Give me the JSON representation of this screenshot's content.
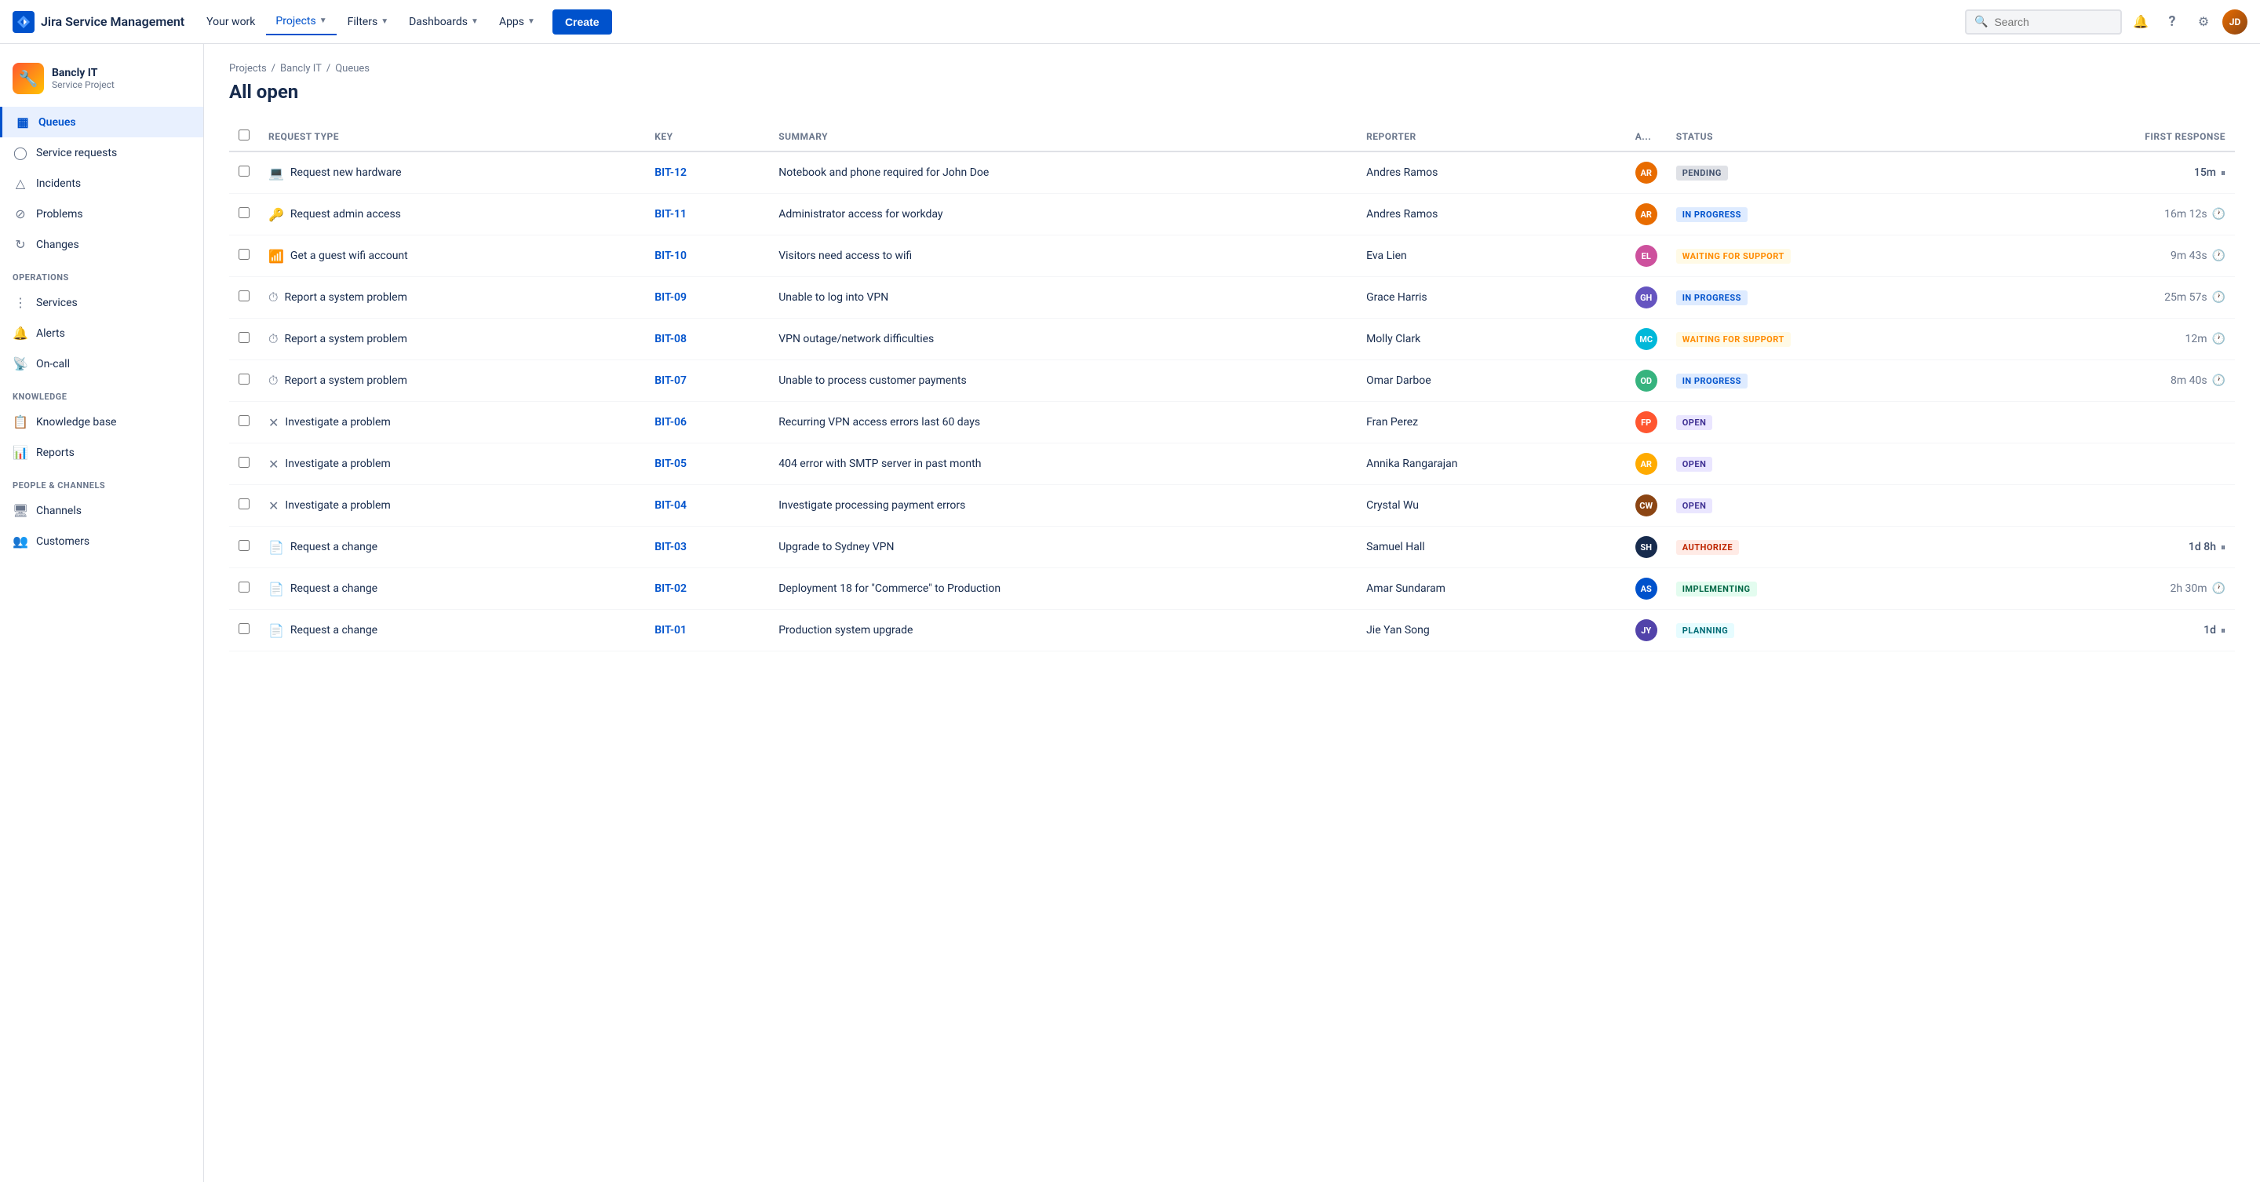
{
  "app": {
    "name": "Jira Service Management"
  },
  "topnav": {
    "your_work": "Your work",
    "projects": "Projects",
    "filters": "Filters",
    "dashboards": "Dashboards",
    "apps": "Apps",
    "create": "Create",
    "search_placeholder": "Search"
  },
  "sidebar": {
    "project_name": "Bancly IT",
    "project_type": "Service Project",
    "items": [
      {
        "id": "queues",
        "label": "Queues",
        "icon": "▦",
        "active": true
      },
      {
        "id": "service-requests",
        "label": "Service requests",
        "icon": "◯"
      },
      {
        "id": "incidents",
        "label": "Incidents",
        "icon": "△"
      },
      {
        "id": "problems",
        "label": "Problems",
        "icon": "⊘"
      },
      {
        "id": "changes",
        "label": "Changes",
        "icon": "⟳"
      }
    ],
    "sections": [
      {
        "label": "OPERATIONS",
        "items": [
          {
            "id": "services",
            "label": "Services",
            "icon": "⋮"
          },
          {
            "id": "alerts",
            "label": "Alerts",
            "icon": "🔔"
          },
          {
            "id": "on-call",
            "label": "On-call",
            "icon": "📡"
          }
        ]
      },
      {
        "label": "KNOWLEDGE",
        "items": [
          {
            "id": "knowledge-base",
            "label": "Knowledge base",
            "icon": "📋"
          },
          {
            "id": "reports",
            "label": "Reports",
            "icon": "📊"
          }
        ]
      },
      {
        "label": "PEOPLE & CHANNELS",
        "items": [
          {
            "id": "channels",
            "label": "Channels",
            "icon": "🖥"
          },
          {
            "id": "customers",
            "label": "Customers",
            "icon": "👥"
          }
        ]
      }
    ]
  },
  "breadcrumb": {
    "projects": "Projects",
    "bancly_it": "Bancly IT",
    "queues": "Queues"
  },
  "page": {
    "title": "All open"
  },
  "table": {
    "headers": {
      "request_type": "Request Type",
      "key": "Key",
      "summary": "Summary",
      "reporter": "Reporter",
      "assignee": "A...",
      "status": "Status",
      "first_response": "First response"
    },
    "rows": [
      {
        "id": "BIT-12",
        "request_type": "Request new hardware",
        "req_icon": "💻",
        "key": "BIT-12",
        "summary": "Notebook and phone required for John Doe",
        "reporter": "Andres Ramos",
        "assignee_color": "#E86C00",
        "assignee_initials": "AR",
        "status": "PENDING",
        "status_class": "badge-pending",
        "first_response": "15m",
        "response_paused": true,
        "has_clock": false
      },
      {
        "id": "BIT-11",
        "request_type": "Request admin access",
        "req_icon": "🔑",
        "key": "BIT-11",
        "summary": "Administrator access for workday",
        "reporter": "Andres Ramos",
        "assignee_color": "#E86C00",
        "assignee_initials": "AR",
        "status": "IN PROGRESS",
        "status_class": "badge-in-progress",
        "first_response": "16m 12s",
        "response_paused": false,
        "has_clock": true
      },
      {
        "id": "BIT-10",
        "request_type": "Get a guest wifi account",
        "req_icon": "📶",
        "key": "BIT-10",
        "summary": "Visitors need access to wifi",
        "reporter": "Eva Lien",
        "assignee_color": "#CD519D",
        "assignee_initials": "EL",
        "status": "WAITING FOR SUPPORT",
        "status_class": "badge-waiting",
        "first_response": "9m 43s",
        "response_paused": false,
        "has_clock": true
      },
      {
        "id": "BIT-09",
        "request_type": "Report a system problem",
        "req_icon": "⏱",
        "key": "BIT-09",
        "summary": "Unable to log into VPN",
        "reporter": "Grace Harris",
        "assignee_color": "#6554C0",
        "assignee_initials": "GH",
        "status": "IN PROGRESS",
        "status_class": "badge-in-progress",
        "first_response": "25m 57s",
        "response_paused": false,
        "has_clock": true
      },
      {
        "id": "BIT-08",
        "request_type": "Report a system problem",
        "req_icon": "⏱",
        "key": "BIT-08",
        "summary": "VPN outage/network difficulties",
        "reporter": "Molly Clark",
        "assignee_color": "#00B8D9",
        "assignee_initials": "MC",
        "status": "WAITING FOR SUPPORT",
        "status_class": "badge-waiting",
        "first_response": "12m",
        "response_paused": false,
        "has_clock": true
      },
      {
        "id": "BIT-07",
        "request_type": "Report a system problem",
        "req_icon": "⏱",
        "key": "BIT-07",
        "summary": "Unable to process customer payments",
        "reporter": "Omar Darboe",
        "assignee_color": "#36B37E",
        "assignee_initials": "OD",
        "status": "IN PROGRESS",
        "status_class": "badge-in-progress",
        "first_response": "8m 40s",
        "response_paused": false,
        "has_clock": true
      },
      {
        "id": "BIT-06",
        "request_type": "Investigate a problem",
        "req_icon": "✕",
        "key": "BIT-06",
        "summary": "Recurring VPN access errors last 60 days",
        "reporter": "Fran Perez",
        "assignee_color": "#FF5630",
        "assignee_initials": "FP",
        "status": "OPEN",
        "status_class": "badge-open",
        "first_response": "",
        "response_paused": false,
        "has_clock": false
      },
      {
        "id": "BIT-05",
        "request_type": "Investigate a problem",
        "req_icon": "✕",
        "key": "BIT-05",
        "summary": "404 error with SMTP server in past month",
        "reporter": "Annika Rangarajan",
        "assignee_color": "#FFAB00",
        "assignee_initials": "AR",
        "status": "OPEN",
        "status_class": "badge-open",
        "first_response": "",
        "response_paused": false,
        "has_clock": false
      },
      {
        "id": "BIT-04",
        "request_type": "Investigate a problem",
        "req_icon": "✕",
        "key": "BIT-04",
        "summary": "Investigate processing payment errors",
        "reporter": "Crystal Wu",
        "assignee_color": "#8B4513",
        "assignee_initials": "CW",
        "status": "OPEN",
        "status_class": "badge-open",
        "first_response": "",
        "response_paused": false,
        "has_clock": false
      },
      {
        "id": "BIT-03",
        "request_type": "Request a change",
        "req_icon": "📄",
        "key": "BIT-03",
        "summary": "Upgrade to Sydney VPN",
        "reporter": "Samuel Hall",
        "assignee_color": "#172B4D",
        "assignee_initials": "SH",
        "status": "AUTHORIZE",
        "status_class": "badge-authorize",
        "first_response": "1d 8h",
        "response_paused": true,
        "has_clock": false
      },
      {
        "id": "BIT-02",
        "request_type": "Request a change",
        "req_icon": "📄",
        "key": "BIT-02",
        "summary": "Deployment 18 for \"Commerce\" to Production",
        "reporter": "Amar Sundaram",
        "assignee_color": "#0052CC",
        "assignee_initials": "AS",
        "status": "IMPLEMENTING",
        "status_class": "badge-implementing",
        "first_response": "2h 30m",
        "response_paused": false,
        "has_clock": true
      },
      {
        "id": "BIT-01",
        "request_type": "Request a change",
        "req_icon": "📄",
        "key": "BIT-01",
        "summary": "Production system upgrade",
        "reporter": "Jie Yan Song",
        "assignee_color": "#5243AA",
        "assignee_initials": "JY",
        "status": "PLANNING",
        "status_class": "badge-planning",
        "first_response": "1d",
        "response_paused": true,
        "has_clock": false
      }
    ]
  }
}
